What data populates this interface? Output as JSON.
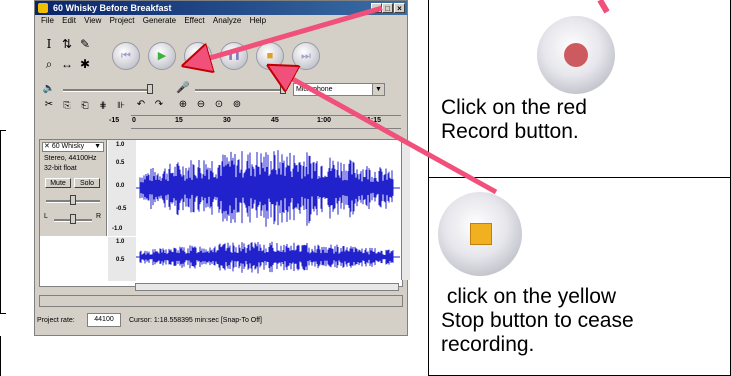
{
  "app": {
    "title": "60 Whisky Before Breakfast",
    "menu": [
      "File",
      "Edit",
      "View",
      "Project",
      "Generate",
      "Effect",
      "Analyze",
      "Help"
    ],
    "tools": {
      "select": "I",
      "envelope": "⇅",
      "draw": "✎",
      "zoom": "⌕",
      "timeshift": "↔",
      "multi": "✱"
    },
    "transport": {
      "skip_start": "⏮",
      "play": "▶",
      "record": "●",
      "pause": "❚❚",
      "stop": "■",
      "skip_end": "⏭"
    },
    "input_source": "Microphone",
    "ruler_ticks": [
      "-15",
      "0",
      "15",
      "30",
      "45",
      "1:00",
      "1:15"
    ],
    "track": {
      "name": "60 Whisky",
      "format": "Stereo, 44100Hz",
      "bit": "32-bit float",
      "mute": "Mute",
      "solo": "Solo",
      "left": "L",
      "right": "R",
      "scale_top": [
        "1.0",
        "0.5",
        "0.0",
        "-0.5",
        "-1.0"
      ],
      "scale_bottom": [
        "1.0",
        "0.5"
      ]
    },
    "status": {
      "rate_label": "Project rate:",
      "rate_value": "44100",
      "cursor": "Cursor: 1:18.558395 min:sec  [Snap-To Off]"
    }
  },
  "instructions": {
    "record_caption": "Click on the red\nRecord button.",
    "stop_caption": " click on the yellow\nStop button to cease\nrecording."
  },
  "colors": {
    "arrow": "#f0507a",
    "record_dot": "#cc5a5e",
    "stop_square": "#f0b020",
    "wave": "#2222cc"
  }
}
